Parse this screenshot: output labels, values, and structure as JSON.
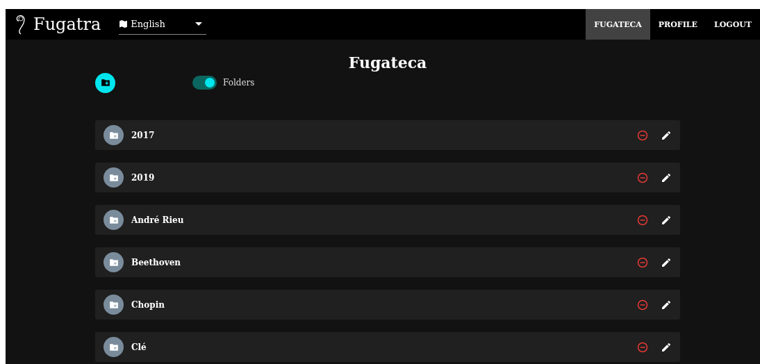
{
  "header": {
    "brand": "Fugatra",
    "language": "English",
    "nav": [
      {
        "label": "FUGATECA",
        "selected": true
      },
      {
        "label": "PROFILE",
        "selected": false
      },
      {
        "label": "LOGOUT",
        "selected": false
      }
    ]
  },
  "page": {
    "title": "Fugateca",
    "folders_toggle": {
      "label": "Folders",
      "on": true
    }
  },
  "folders": [
    {
      "name": "2017"
    },
    {
      "name": "2019"
    },
    {
      "name": "André Rieu"
    },
    {
      "name": "Beethoven"
    },
    {
      "name": "Chopin"
    },
    {
      "name": "Clé"
    }
  ]
}
